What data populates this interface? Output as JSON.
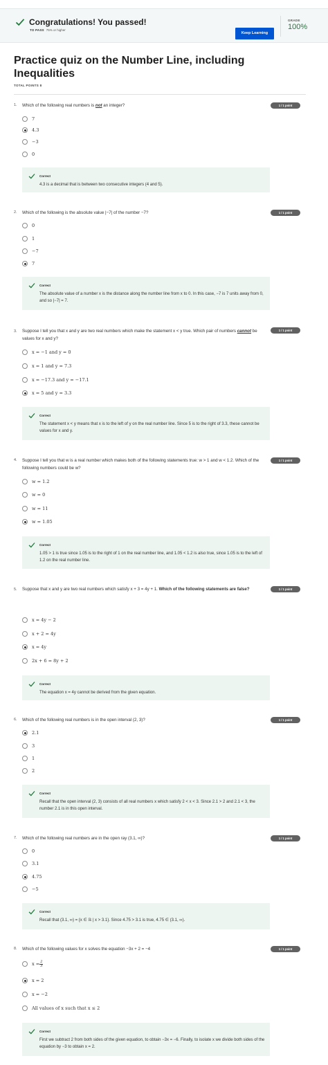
{
  "banner": {
    "title": "Congratulations! You passed!",
    "to_pass_label": "TO PASS",
    "to_pass_value": "75% or higher",
    "keep_learning": "Keep Learning",
    "grade_label": "GRADE",
    "grade_value": "100%"
  },
  "quiz": {
    "title": "Practice quiz on the Number Line, including Inequalities",
    "total_points": "TOTAL POINTS 8"
  },
  "colors": {
    "accent": "#0056d2",
    "success": "#1f7a3c",
    "feedback_bg": "#edf5f0",
    "points_badge": "#616161"
  },
  "icons": {
    "check": "check-icon"
  },
  "questions": [
    {
      "number": "1.",
      "text_a": "Which of the following real numbers is ",
      "text_em": "not",
      "text_b": " an integer?",
      "points": "1 / 1 point",
      "options": [
        "7",
        "4.3",
        "−3",
        "0"
      ],
      "selected": 1,
      "feedback_label": "Correct",
      "feedback": "4.3 is a decimal that is between two consecutive integers (4 and 5)."
    },
    {
      "number": "2.",
      "text": "Which of the following is the absolute value |−7| of the number −7?",
      "points": "1 / 1 point",
      "options": [
        "0",
        "1",
        "−7",
        "7"
      ],
      "selected": 3,
      "feedback_label": "Correct",
      "feedback": "The absolute value of a number x is the distance along the number line from x to 0. In this case, −7 is 7 units away from 0, and so |−7| = 7."
    },
    {
      "number": "3.",
      "text_a": "Suppose I tell you that x and y are two real numbers which make the statement x < y true. Which pair of numbers ",
      "text_em": "cannot",
      "text_b": " be values for x and y?",
      "points": "1 / 1 point",
      "options": [
        "x = −1 and y = 0",
        "x = 1 and y = 7.3",
        "x = −17.3 and y = −17.1",
        "x = 5 and y = 3.3"
      ],
      "selected": 3,
      "feedback_label": "Correct",
      "feedback": "The statement x < y means that x is to the left of y on the real number line. Since 5 is to the right of 3.3, these cannot be values for x and y."
    },
    {
      "number": "4.",
      "text": "Suppose I tell you that w is a real number which makes both of the following statements true: w > 1 and w < 1.2. Which of the following numbers could be w?",
      "points": "1 / 1 point",
      "options": [
        "w = 1.2",
        "w = 0",
        "w = 11",
        "w = 1.05"
      ],
      "selected": 3,
      "feedback_label": "Correct",
      "feedback": "1.05 > 1 is true since 1.05 is to the right of 1 on the real number line, and 1.05 < 1.2 is also true, since 1.05 is to the left of 1.2 on the real number line."
    },
    {
      "number": "5.",
      "text_a": "Suppose that x and y are two real numbers which satisfy x + 3 = 4y + 1. ",
      "text_bold": "Which of the following statements are false?",
      "points": "1 / 1 point",
      "options": [
        "x = 4y − 2",
        "x + 2 = 4y",
        "x = 4y",
        "2x + 6 = 8y + 2"
      ],
      "selected": 2,
      "feedback_label": "Correct",
      "feedback": "The equation x = 4y cannot be derived from the given equation."
    },
    {
      "number": "6.",
      "text": "Which of the following real numbers is in the open interval (2, 3)?",
      "points": "1 / 1 point",
      "options": [
        "2.1",
        "3",
        "1",
        "2"
      ],
      "selected": 0,
      "feedback_label": "Correct",
      "feedback": "Recall that the open interval (2, 3) consists of all real numbers x which satisfy 2 < x < 3. Since 2.1 > 2 and 2.1 < 3, the number 2.1 is in this open interval."
    },
    {
      "number": "7.",
      "text": "Which of the following real numbers are in the open ray (3.1, ∞)?",
      "points": "1 / 1 point",
      "options": [
        "0",
        "3.1",
        "4.75",
        "−5"
      ],
      "selected": 2,
      "feedback_label": "Correct",
      "feedback": "Recall that (3.1, ∞) = {x ∈ ℝ | x > 3.1}. Since 4.75 > 3.1 is true, 4.75 ∈ (3.1, ∞)."
    },
    {
      "number": "8.",
      "text": "Which of the following values for x solves the equation −3x + 2 = −4",
      "points": "1 / 1 point",
      "options": [
        "x = ",
        "x = 2",
        "x = −2",
        "All values of x such that x ≤ 2"
      ],
      "option0_frac_num": "2",
      "option0_frac_den": "3",
      "selected": 1,
      "feedback_label": "Correct",
      "feedback": "First we subtract 2 from both sides of the given equation, to obtain −3x = −6. Finally, to isolate x we divide both sides of the equation by −3 to obtain x = 2."
    }
  ]
}
